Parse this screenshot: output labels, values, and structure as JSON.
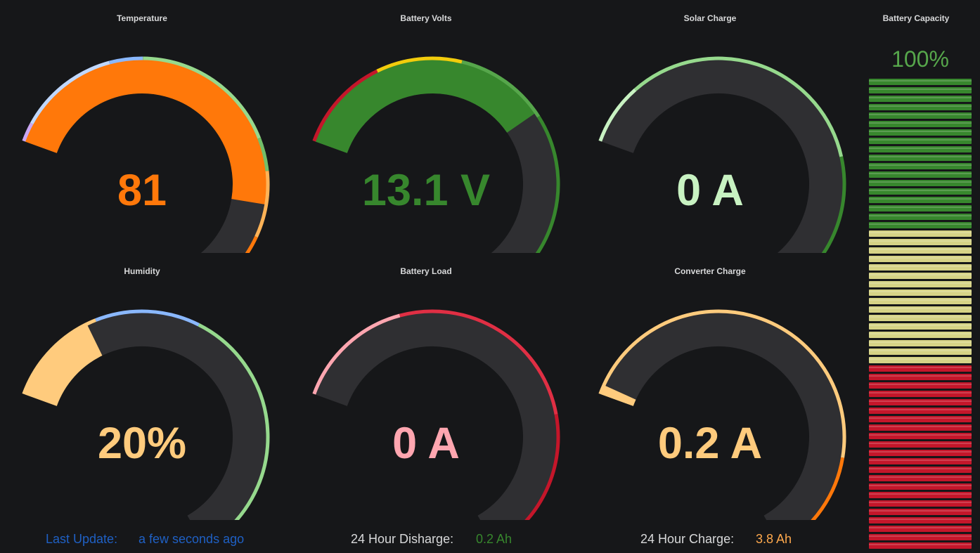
{
  "colors": {
    "background": "#161719",
    "track": "#2f2f32",
    "orange": "#ff780a",
    "green": "#37872d",
    "light_green": "#c8f2c2",
    "light_orange": "#ffcb7d",
    "pink": "#ffa6b0",
    "blue_text": "#1f60c4",
    "mid_green": "#56a64b",
    "yellow": "#d6d386",
    "red": "#c4162a"
  },
  "gauges": {
    "temperature": {
      "title": "Temperature",
      "value": "81",
      "fill_fraction": 0.77,
      "color": "#ff780a"
    },
    "battery_volts": {
      "title": "Battery Volts",
      "value": "13.1 V",
      "fill_fraction": 0.57,
      "color": "#37872d"
    },
    "solar_charge": {
      "title": "Solar Charge",
      "value": "0 A",
      "fill_fraction": 0.0,
      "color": "#c8f2c2"
    },
    "humidity": {
      "title": "Humidity",
      "value": "20%",
      "fill_fraction": 0.2,
      "color": "#ffcb7d"
    },
    "battery_load": {
      "title": "Battery Load",
      "value": "0 A",
      "fill_fraction": 0.0,
      "color": "#ffa6b0"
    },
    "converter_charge": {
      "title": "Converter Charge",
      "value": "0.2 A",
      "fill_fraction": 0.02,
      "color": "#ffcb7d"
    }
  },
  "battery_capacity": {
    "title": "Battery Capacity",
    "value": "100%",
    "level": 1.0
  },
  "footer": {
    "last_update_label": "Last Update:",
    "last_update_value": "a few seconds ago",
    "discharge_label": "24 Hour Disharge:",
    "discharge_value": "0.2 Ah",
    "charge_label": "24 Hour Charge:",
    "charge_value": "3.8 Ah"
  }
}
